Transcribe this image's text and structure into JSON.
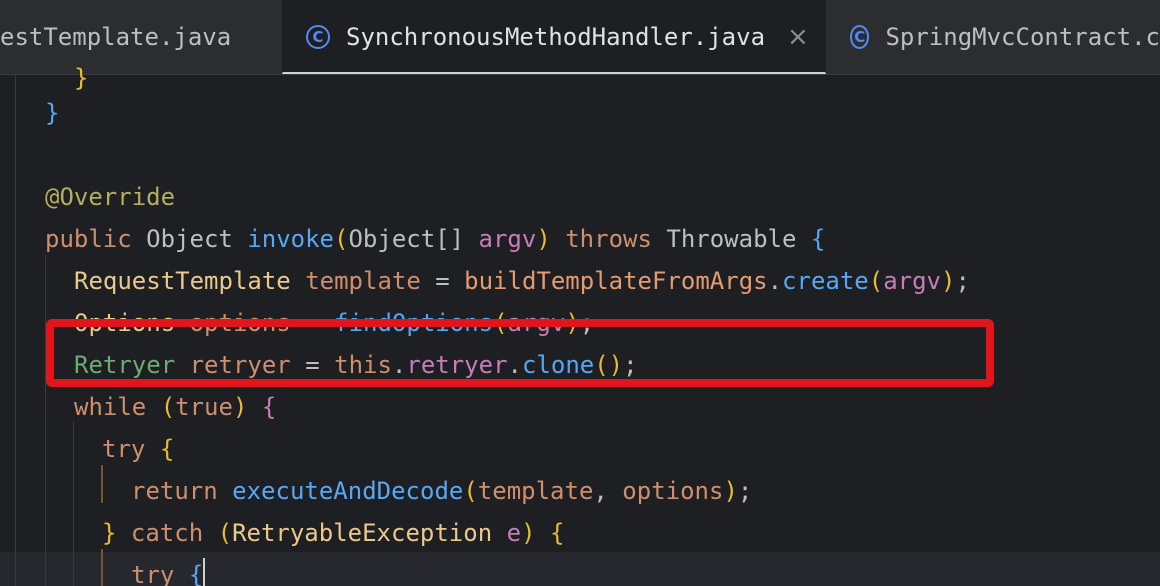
{
  "tabs": [
    {
      "label": "estTemplate.java",
      "active": false,
      "icon": "none"
    },
    {
      "label": "SynchronousMethodHandler.java",
      "active": true,
      "icon": "class-icon",
      "close": "×"
    },
    {
      "label": "SpringMvcContract.c",
      "active": false,
      "icon": "class-icon"
    }
  ],
  "code": {
    "brace_partial": "}",
    "brace_close": "}",
    "annotation": "@Override",
    "sig": {
      "public": "public",
      "object": "Object",
      "invoke": "invoke",
      "open": "(",
      "argtype": "Object[]",
      "argv": "argv",
      "close": ")",
      "throws": "throws",
      "throwable": "Throwable",
      "brace": "{"
    },
    "line1": {
      "type": "RequestTemplate",
      "var": "template",
      "eq": "=",
      "builder": "buildTemplateFromArgs",
      "dot": ".",
      "method": "create",
      "open": "(",
      "arg": "argv",
      "close": ")",
      "semi": ";"
    },
    "line2": {
      "type": "Options",
      "var": "options",
      "eq": "=",
      "method": "findOptions",
      "open": "(",
      "arg": "argv",
      "close": ")",
      "semi": ";"
    },
    "line3": {
      "type": "Retryer",
      "var": "retryer",
      "eq": "=",
      "this": "this",
      "dot1": ".",
      "field": "retryer",
      "dot2": ".",
      "method": "clone",
      "parens": "()",
      "semi": ";"
    },
    "line4": {
      "kw": "while",
      "open": "(",
      "cond": "true",
      "close": ")",
      "brace": "{"
    },
    "line5": {
      "kw": "try",
      "brace": "{"
    },
    "line6": {
      "kw": "return",
      "method": "executeAndDecode",
      "open": "(",
      "a1": "template",
      "comma": ",",
      "a2": "options",
      "close": ")",
      "semi": ";"
    },
    "line7": {
      "brace": "}",
      "kw": "catch",
      "open": "(",
      "type": "RetryableException",
      "var": "e",
      "close": ")",
      "brace2": "{"
    },
    "line8": {
      "kw": "try",
      "brace": "{"
    }
  },
  "colors": {
    "background": "#1e1f22",
    "tabbar": "#2b2d30",
    "highlight_box": "#e0161c",
    "keyword": "#cf8e6d",
    "method": "#56a8f5",
    "annotation": "#b3ae60"
  }
}
